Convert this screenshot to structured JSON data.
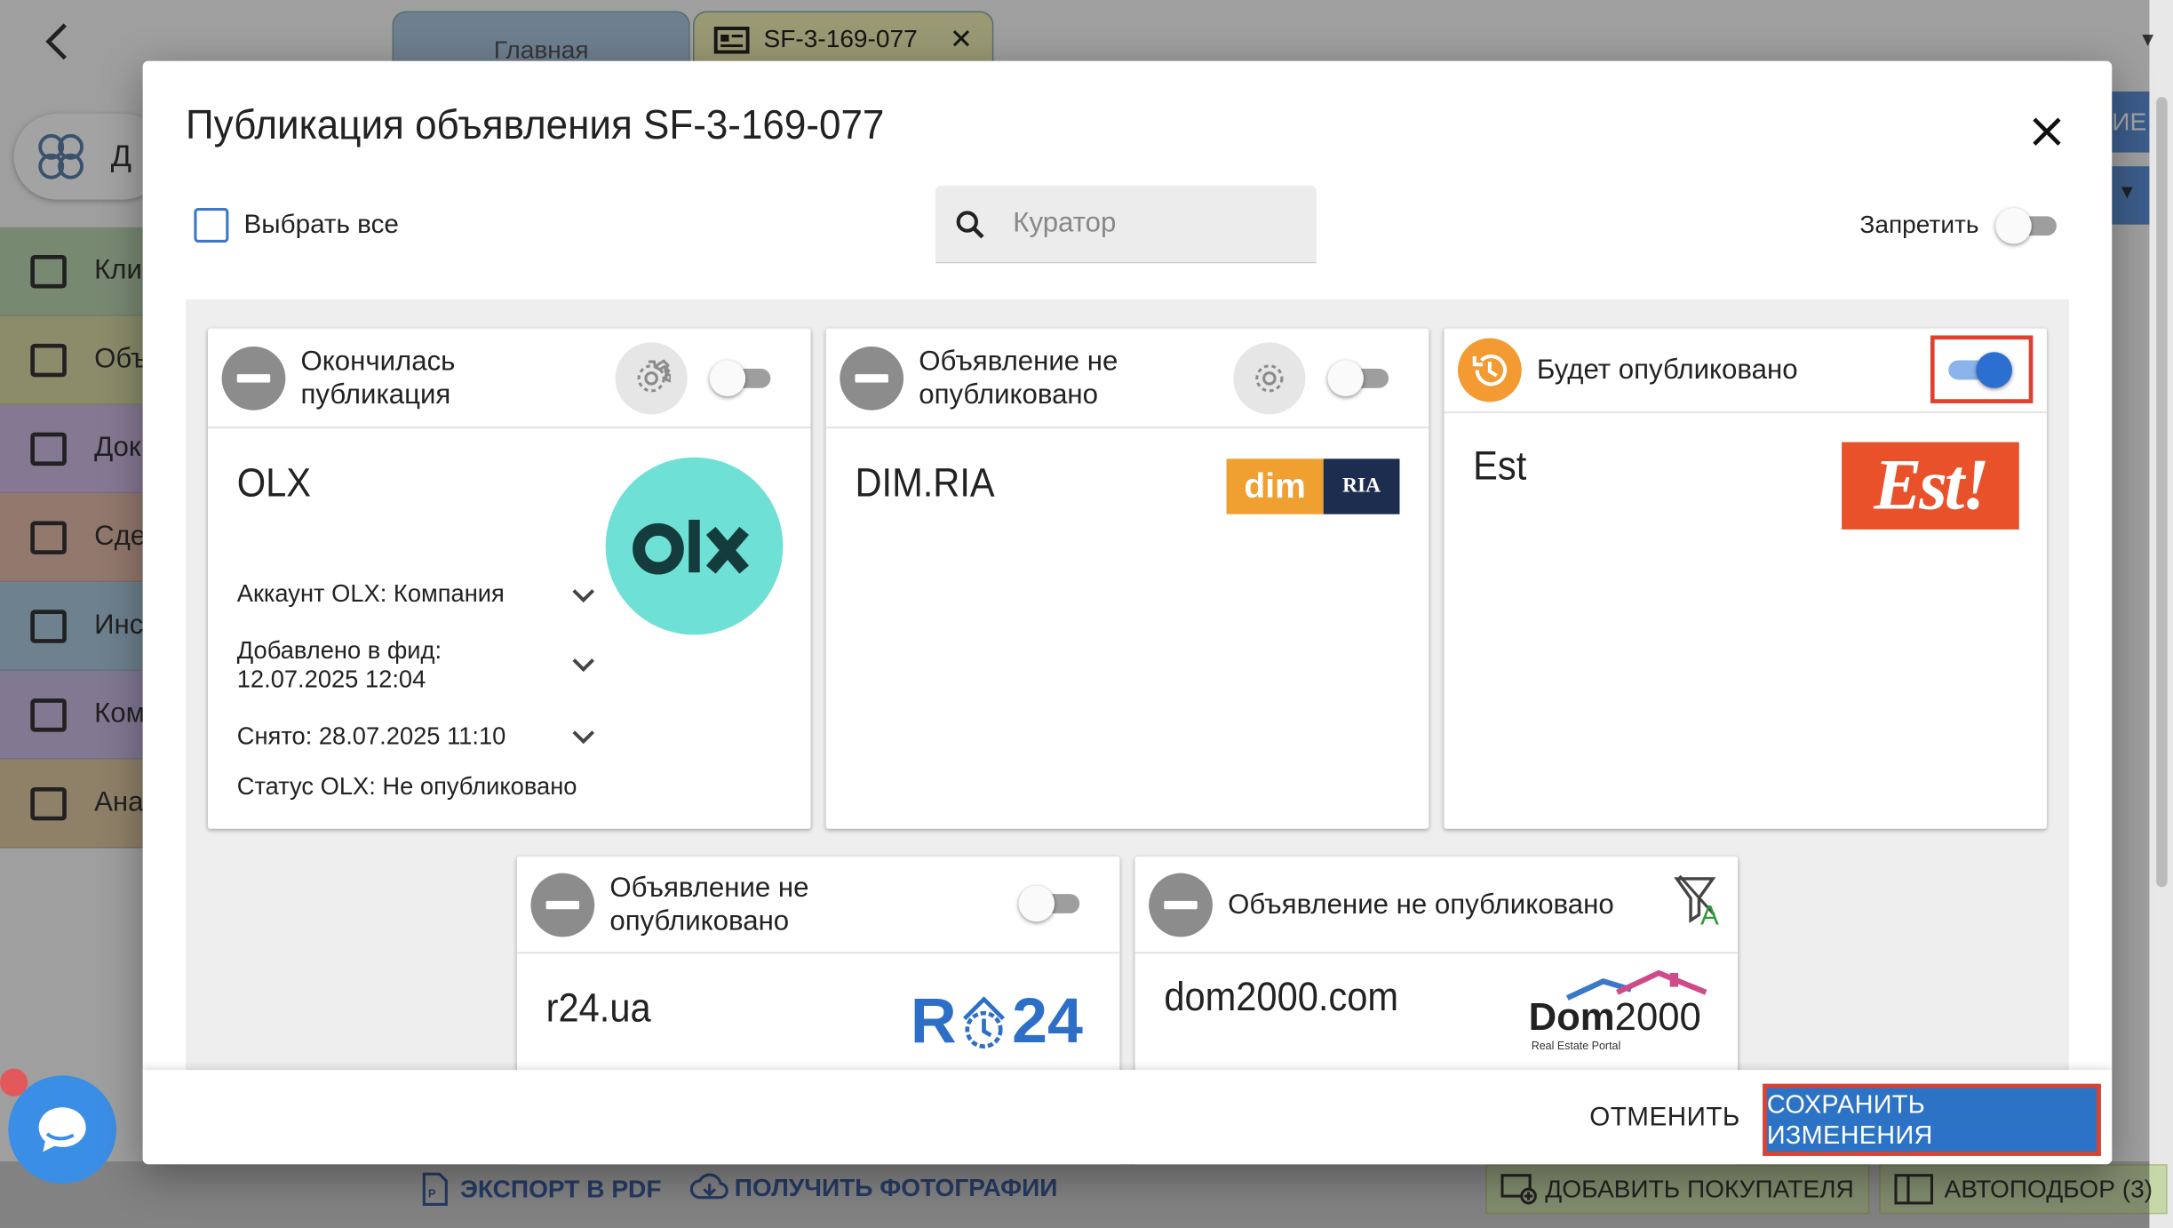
{
  "app": {
    "tabs": [
      {
        "label": "Главная"
      },
      {
        "label": "SF-3-169-077"
      }
    ],
    "user_short": "Д",
    "sidebar": [
      {
        "label": "Кли",
        "icon": "contacts-icon",
        "color": "#b8d3b0"
      },
      {
        "label": "Объ",
        "icon": "listings-icon",
        "color": "#d4d8a4"
      },
      {
        "label": "Док",
        "icon": "folder-icon",
        "color": "#cdb8e2"
      },
      {
        "label": "Сде",
        "icon": "deals-icon",
        "color": "#e0b8a8"
      },
      {
        "label": "Инс",
        "icon": "tools-icon",
        "color": "#a8c6dc"
      },
      {
        "label": "Ком",
        "icon": "copyright-icon",
        "color": "#c6b8e0"
      },
      {
        "label": "Ана",
        "icon": "analytics-icon",
        "color": "#dcc6a0"
      }
    ],
    "right_button_fragment": "ИЕ",
    "bottom": {
      "export_pdf": "ЭКСПОРТ В PDF",
      "get_photos": "ПОЛУЧИТЬ ФОТОГРАФИИ",
      "add_buyer": "ДОБАВИТЬ ПОКУПАТЕЛЯ",
      "autoselect": "АВТОПОДБОР (3)"
    }
  },
  "dialog": {
    "title": "Публикация объявления SF-3-169-077",
    "select_all": "Выбрать все",
    "search_placeholder": "Куратор",
    "forbid_label": "Запретить",
    "forbid_on": false,
    "cards": [
      {
        "name": "OLX",
        "status": "Окончилась публикация",
        "status_icon": "minus-circle-icon",
        "enabled": false,
        "logo": "olx-logo",
        "details": [
          "Аккаунт OLX: Компания",
          "Добавлено в фид: 12.07.2025 12:04",
          "Снято: 28.07.2025 11:10",
          "Статус OLX: Не опубликовано"
        ]
      },
      {
        "name": "DIM.RIA",
        "status": "Объявление не опубликовано",
        "status_icon": "minus-circle-icon",
        "enabled": false,
        "logo": "dim-ria-logo",
        "logo_text": "dim",
        "logo_text2": "RIA"
      },
      {
        "name": "Est",
        "status": "Будет опубликовано",
        "status_icon": "scheduled-clock-icon",
        "enabled": true,
        "logo": "est-logo",
        "logo_text": "Est!"
      },
      {
        "name": "r24.ua",
        "status": "Объявление не опубликовано",
        "status_icon": "minus-circle-icon",
        "enabled": false,
        "logo": "r24-logo",
        "logo_text": "R",
        "logo_text2": "24"
      },
      {
        "name": "dom2000.com",
        "status": "Объявление не опубликовано",
        "status_icon": "minus-circle-icon",
        "logo": "dom2000-logo",
        "logo_text": "Dom",
        "logo_text2": "2000",
        "logo_sub": "Real Estate Portal",
        "filter_badge": "A"
      }
    ],
    "cancel_label": "ОТМЕНИТЬ",
    "save_label": "СОХРАНИТЬ ИЗМЕНЕНИЯ"
  },
  "colors": {
    "accent": "#2c73c6",
    "highlight": "#e0412f",
    "olx_bg": "#6fe0d6",
    "est_bg": "#e8512a",
    "dim_orange": "#f0a030",
    "ria_navy": "#1d2d50",
    "scheduled": "#f39a33"
  }
}
